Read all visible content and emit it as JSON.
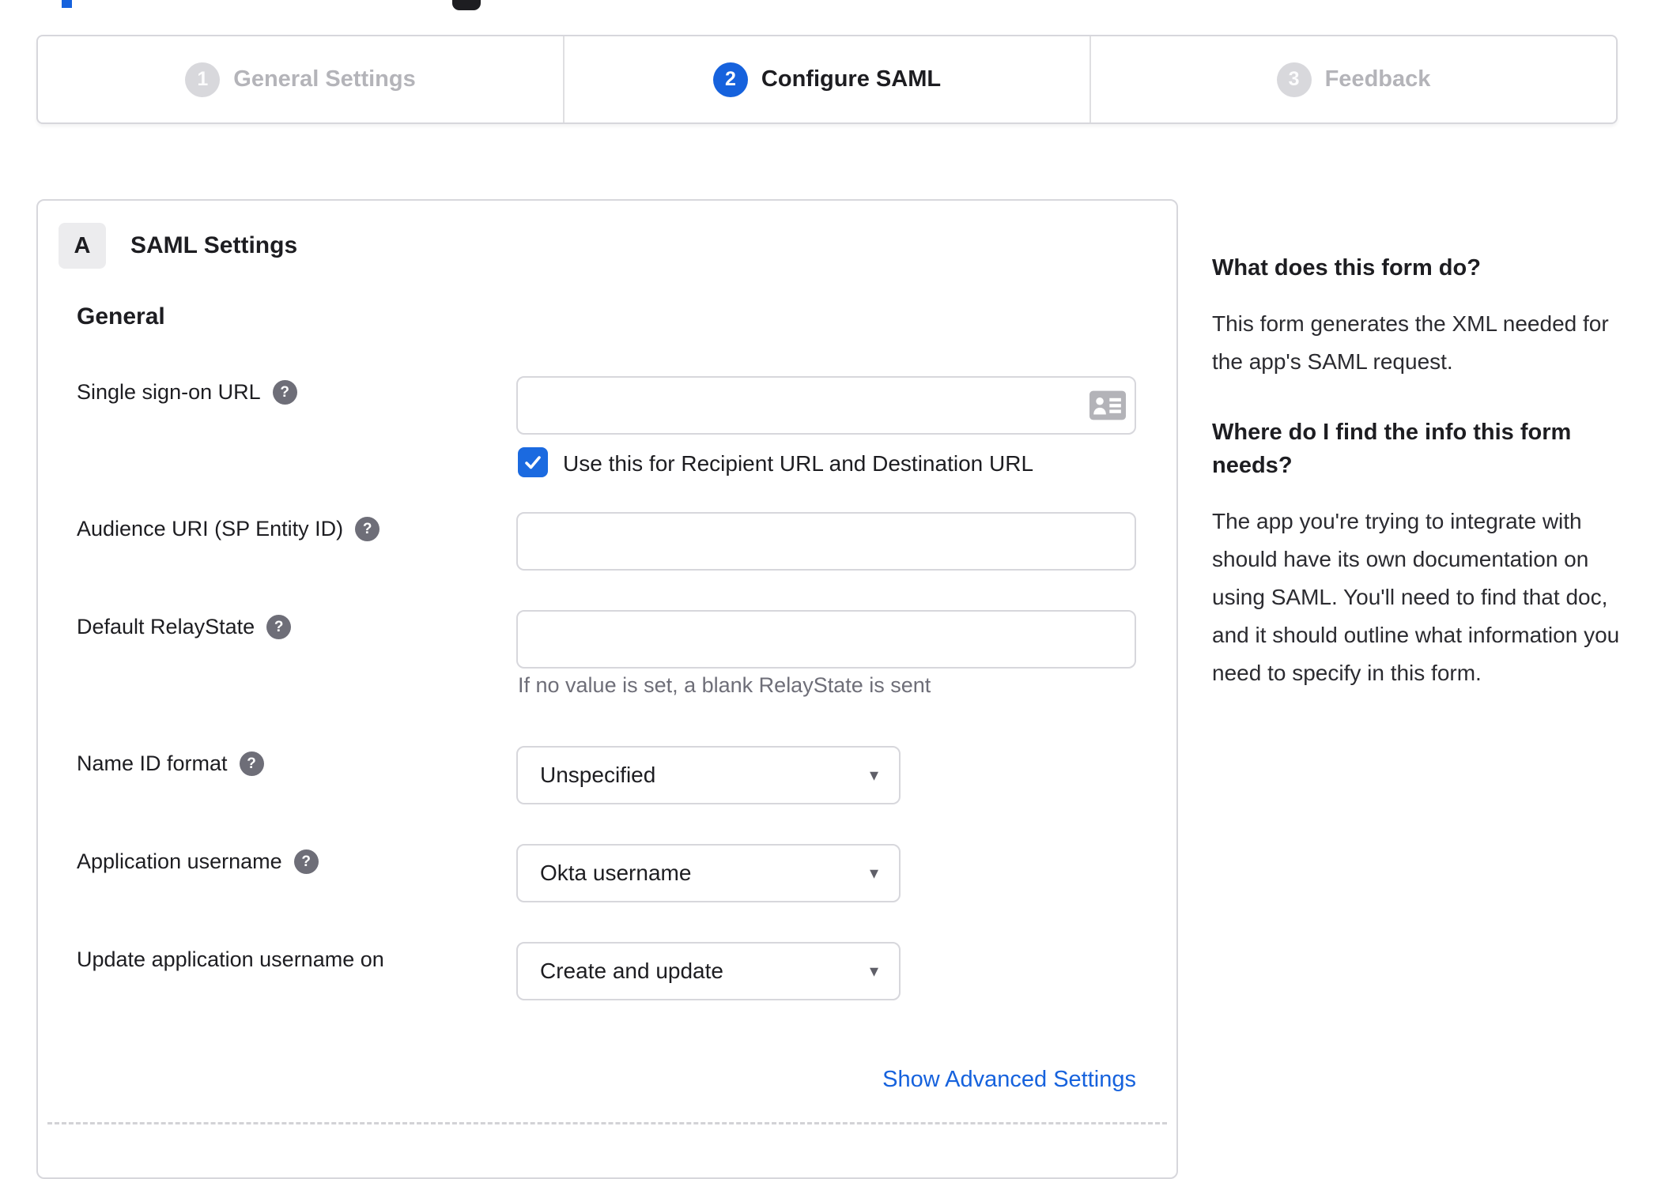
{
  "colors": {
    "accent_blue": "#1662dd",
    "checkbox_blue": "#1b6ae0",
    "border_gray": "#d7d7dc",
    "text_dark": "#1d1d21",
    "muted_gray": "#6e6e78",
    "inactive_gray": "#b4b4b9"
  },
  "icons": {
    "help_glyph": "?",
    "caret_glyph": "▾",
    "checkmark": "check-icon",
    "input_trailing": "contact-card-icon"
  },
  "stepper": {
    "steps": [
      {
        "number": "1",
        "label": "General Settings",
        "state": "inactive"
      },
      {
        "number": "2",
        "label": "Configure SAML",
        "state": "active"
      },
      {
        "number": "3",
        "label": "Feedback",
        "state": "inactive"
      }
    ]
  },
  "panel": {
    "badge": "A",
    "title": "SAML Settings",
    "section": "General",
    "sso": {
      "label": "Single sign-on URL",
      "value": "",
      "placeholder": ""
    },
    "checkbox": {
      "label": "Use this for Recipient URL and Destination URL",
      "checked": true
    },
    "audience": {
      "label": "Audience URI (SP Entity ID)",
      "value": "",
      "placeholder": ""
    },
    "relay": {
      "label": "Default RelayState",
      "value": "",
      "placeholder": "",
      "hint": "If no value is set, a blank RelayState is sent"
    },
    "name_id": {
      "label": "Name ID format",
      "value": "Unspecified"
    },
    "app_user": {
      "label": "Application username",
      "value": "Okta username"
    },
    "update_user": {
      "label": "Update application username on",
      "value": "Create and update"
    },
    "advanced_link": "Show Advanced Settings"
  },
  "sidebar": {
    "heading1": "What does this form do?",
    "para1": "This form generates the XML needed for the app's SAML request.",
    "heading2": "Where do I find the info this form needs?",
    "para2": "The app you're trying to integrate with should have its own documentation on using SAML. You'll need to find that doc, and it should outline what information you need to specify in this form."
  }
}
